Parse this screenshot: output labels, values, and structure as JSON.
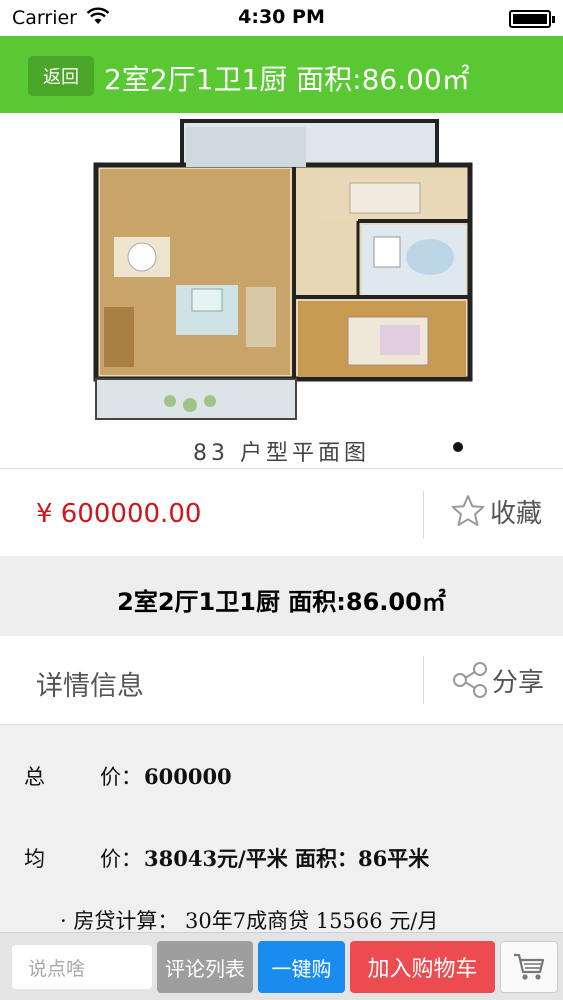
{
  "status_bar": {
    "carrier": "Carrier",
    "time": "4:30 PM"
  },
  "nav": {
    "back_label": "返回",
    "title": "2室2厅1卫1厨 面积:86.00㎡"
  },
  "image": {
    "caption": "83 户型平面图"
  },
  "price": {
    "text": "¥ 600000.00",
    "favorite_label": "收藏"
  },
  "listing": {
    "title": "2室2厅1卫1厨 面积:86.00㎡"
  },
  "details": {
    "header": "详情信息",
    "share_label": "分享",
    "total_price_label_1": "总",
    "total_price_label_2": "价：",
    "total_price_value": "600000",
    "unit_price_label_1": "均",
    "unit_price_label_2": "价：",
    "unit_price_value": "38043元/平米 面积：86平米",
    "mortgage_text": "· 房贷计算： 30年7成商贷 15566 元/月"
  },
  "toolbar": {
    "comment_placeholder": "说点啥",
    "comment_list_label": "评论列表",
    "buy_now_label": "一键购",
    "add_cart_label": "加入购物车"
  },
  "colors": {
    "nav_green": "#5ac833",
    "price_red": "#d0161b",
    "buy_blue": "#1a8cf0",
    "cart_red": "#ec4b4f"
  }
}
